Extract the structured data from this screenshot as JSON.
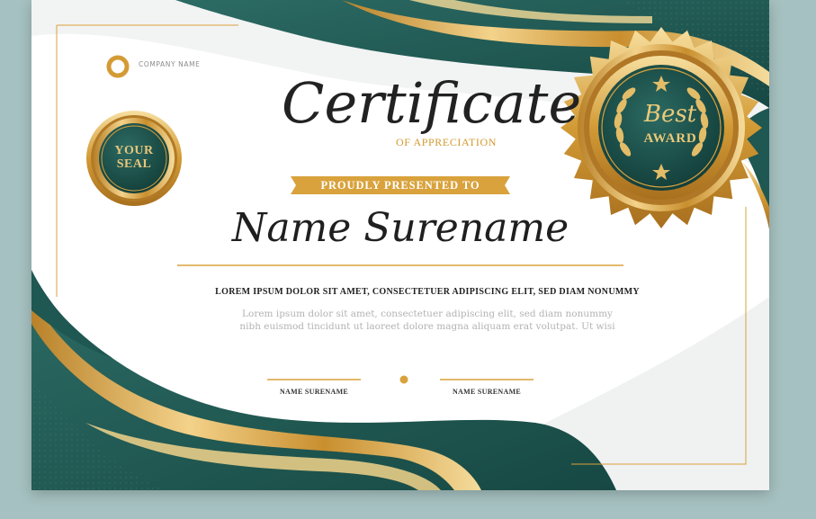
{
  "certificate": {
    "company_name": "COMPANY NAME",
    "title": "Certificate",
    "subtitle": "OF APPRECIATION",
    "presented_banner": "PROUDLY PRESENTED TO",
    "recipient_name": "Name Surename",
    "lead_text": "LOREM IPSUM DOLOR SIT AMET, CONSECTETUER ADIPISCING ELIT, SED DIAM NONUMMY",
    "body_line1": "Lorem ipsum dolor sit amet, consectetuer adipiscing elit, sed diam nonummy",
    "body_line2": "nibh euismod tincidunt ut laoreet dolore magna aliquam erat volutpat. Ut wisi",
    "signatures": [
      {
        "label": "NAME SURENAME"
      },
      {
        "label": "NAME SURENAME"
      }
    ]
  },
  "seal": {
    "line1": "YOUR",
    "line2": "SEAL"
  },
  "badge": {
    "line1": "Best",
    "line2": "AWARD"
  },
  "colors": {
    "teal": "#1f5752",
    "gold": "#d9a23c",
    "page_background": "#a6c1c1"
  }
}
